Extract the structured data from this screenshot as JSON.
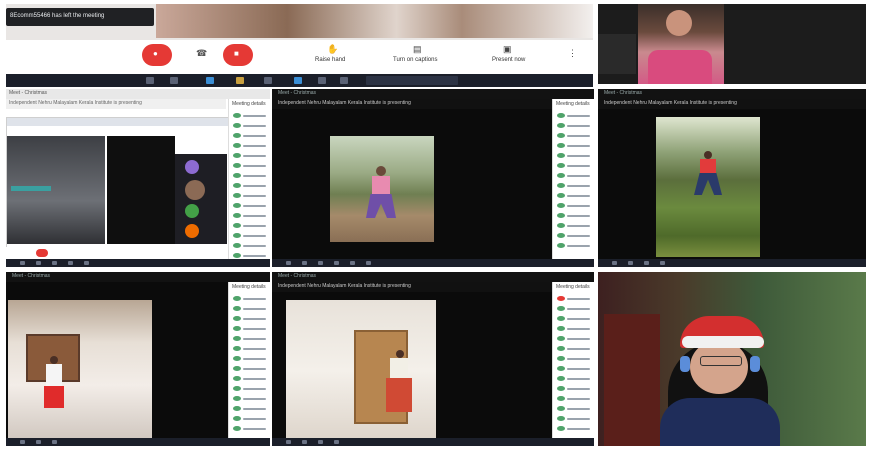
{
  "meeting": {
    "notification": "8Ecomm55466 has left the meeting",
    "controls": {
      "raise_hand": "Raise hand",
      "captions": "Turn on captions",
      "present": "Present now"
    }
  },
  "tiles": {
    "tile1": {
      "title": "Meet - Christmas",
      "caption": "Independent Nehru Malayalam Kerala Institute is presenting"
    },
    "tile2": {
      "title": "Meet - Christmas",
      "caption": "Independent Nehru Malayalam Kerala Institute is presenting"
    },
    "tile3": {
      "title": "Meet - Christmas",
      "caption": "Independent Nehru Malayalam Kerala Institute is presenting"
    },
    "tile4": {
      "title": "Meet - Christmas",
      "caption": "Independent Nehru Malayalam Kerala Institute is presenting"
    },
    "tile5": {
      "title": "Meet - Christmas",
      "caption": "Independent Nehru Malayalam Kerala Institute is presenting"
    }
  },
  "chat_header": "Meeting details",
  "colors": {
    "accent_red": "#e53935",
    "dark_bg": "#0b0b0b",
    "panel_white": "#ffffff",
    "green_avatar": "#4fa36a"
  },
  "icons": [
    "hang-up-icon",
    "mic-icon",
    "camera-icon",
    "hand-icon",
    "captions-icon",
    "present-icon",
    "more-icon"
  ]
}
